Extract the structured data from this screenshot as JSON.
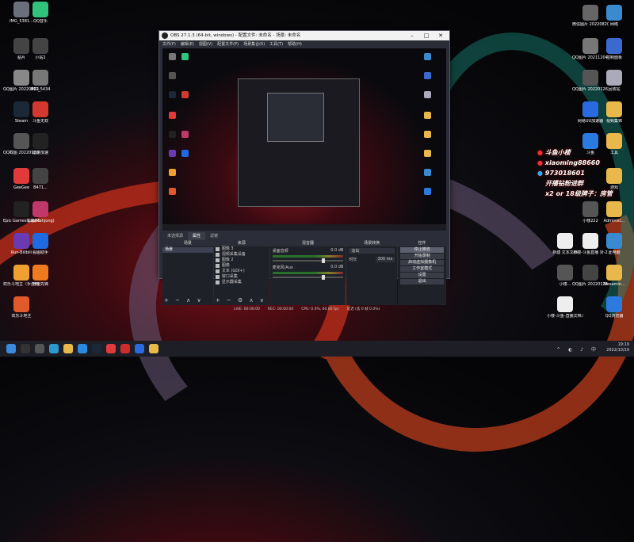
{
  "desktop_left": [
    {
      "label": "IMG_5381...",
      "color": "#6b6f7a"
    },
    {
      "label": "QQ音乐",
      "color": "#31c27c"
    },
    {
      "label": "贴片",
      "color": "#444"
    },
    {
      "label": "小站2",
      "color": "#444"
    },
    {
      "label": "QQ图片 20220823...",
      "color": "#888"
    },
    {
      "label": "IMG_5434",
      "color": "#777"
    },
    {
      "label": "Steam",
      "color": "#1b2838"
    },
    {
      "label": "斗鱼无双",
      "color": "#d2382d"
    },
    {
      "label": "QQ截图 20220920...",
      "color": "#555"
    },
    {
      "label": "迅游加速",
      "color": "#222"
    },
    {
      "label": "GeeGee",
      "color": "#e03a3a"
    },
    {
      "label": "B471...",
      "color": "#444"
    },
    {
      "label": "Epic Games Launcher",
      "color": "#222"
    },
    {
      "label": "雀魂(Mahjong)",
      "color": "#c0386a"
    },
    {
      "label": "Run-Bilibili",
      "color": "#6a3ab2"
    },
    {
      "label": "看图助手",
      "color": "#1e6ae0"
    },
    {
      "label": "欢乐斗地主（手游网易版）",
      "color": "#f0a030"
    },
    {
      "label": "守望先锋",
      "color": "#f07a1e"
    },
    {
      "label": "欢乐斗地主",
      "color": "#e05a2a"
    }
  ],
  "desktop_right": [
    {
      "label": "微信图片 20220820...",
      "color": "#666"
    },
    {
      "label": "网络",
      "color": "#3a8ad0"
    },
    {
      "label": "QQ图片 20211204...",
      "color": "#777"
    },
    {
      "label": "控制面板",
      "color": "#3a6ad0"
    },
    {
      "label": "QQ图片 20220126...",
      "color": "#555"
    },
    {
      "label": "回收站",
      "color": "#aab"
    },
    {
      "label": "网易UU加速器",
      "color": "#2a6ae0"
    },
    {
      "label": "视频集锦",
      "color": "#e8b84a"
    },
    {
      "label": "斗鱼",
      "color": "#2a7ae0"
    },
    {
      "label": "工具",
      "color": "#e8b84a"
    },
    {
      "label": "游戏",
      "color": "#e8b84a"
    },
    {
      "label": "小楼222",
      "color": "#555"
    },
    {
      "label": "Administ...",
      "color": "#e8b84a"
    },
    {
      "label": "新建 文本文档",
      "color": "#eee"
    },
    {
      "label": "小楼-斗鱼直播 对-2",
      "color": "#eee"
    },
    {
      "label": "此电脑",
      "color": "#3a8ad0"
    },
    {
      "label": "小楼...",
      "color": "#555"
    },
    {
      "label": "QQ图片 20220126...",
      "color": "#444"
    },
    {
      "label": "Streamin...",
      "color": "#e8b84a"
    },
    {
      "label": "小楼-斗鱼-直播文档.txt",
      "color": "#eee"
    },
    {
      "label": "QQ浏览器",
      "color": "#2a7ae0"
    }
  ],
  "obs": {
    "title": "OBS 27.1.3 (64-bit, windows) - 配置文件: 未命名 - 场景: 未命名",
    "menu": [
      "文件(F)",
      "编辑(E)",
      "视图(V)",
      "配置文件(P)",
      "场景集合(S)",
      "工具(T)",
      "帮助(H)"
    ],
    "tabs": [
      "未选择源",
      "属性",
      "滤镜"
    ],
    "docks": {
      "scenes": {
        "header": "场景",
        "items": [
          "场景"
        ],
        "footer": "+ − ∧ ∨"
      },
      "sources": {
        "header": "来源",
        "items": [
          "图像 3",
          "视频采集设备",
          "图像 2",
          "图像",
          "文本 (GDI+)",
          "窗口采集",
          "显示器采集"
        ],
        "footer": "+ − ⚙ ∧ ∨"
      },
      "mixer": {
        "header": "混音器",
        "channels": [
          {
            "name": "桌面音频",
            "db": "0.0 dB"
          },
          {
            "name": "麦克风/Aux",
            "db": "0.0 dB"
          }
        ]
      },
      "transitions": {
        "header": "场景转换",
        "type": "淡出",
        "duration_label": "时长",
        "duration": "300 ms"
      },
      "controls": {
        "header": "控件",
        "buttons": [
          "停止推流",
          "开始录制",
          "启动虚拟摄像机",
          "工作室模式",
          "设置",
          "退出"
        ]
      }
    },
    "status": {
      "live": "LIVE: 00:00:00",
      "rec": "REC: 00:00:00",
      "cpu": "CPU: 0.0%, 60.00 fps",
      "dropped": "延迟 (丢 0 帧 0.0%)"
    }
  },
  "overlay": [
    {
      "icon": "weibo-icon",
      "text": "斗鱼小楼"
    },
    {
      "icon": "weibo-icon",
      "text": "xiaoming88660"
    },
    {
      "icon": "qq-icon",
      "text": "973018601"
    },
    {
      "icon": "",
      "text": "开播钻粉进群"
    },
    {
      "icon": "",
      "text": "x2  or 18级牌子：房管"
    }
  ],
  "taskbar": {
    "icons": [
      {
        "name": "windows-start-icon",
        "color": "#3a8ae0"
      },
      {
        "name": "obs-taskbar-icon",
        "color": "#333"
      },
      {
        "name": "search-icon",
        "color": "#555"
      },
      {
        "name": "edge-icon",
        "color": "#2a9ad0"
      },
      {
        "name": "folder-icon",
        "color": "#e8b84a"
      },
      {
        "name": "qq-icon",
        "color": "#2a8ae0"
      },
      {
        "name": "steam-icon",
        "color": "#1b2838"
      },
      {
        "name": "douyu-icon",
        "color": "#e03a3a"
      },
      {
        "name": "netease-icon",
        "color": "#d02a2a"
      },
      {
        "name": "uu-icon",
        "color": "#2a6ae0"
      },
      {
        "name": "folder2-icon",
        "color": "#e8b84a"
      }
    ],
    "time": "19:19",
    "date": "2022/10/19",
    "lang": "中"
  }
}
